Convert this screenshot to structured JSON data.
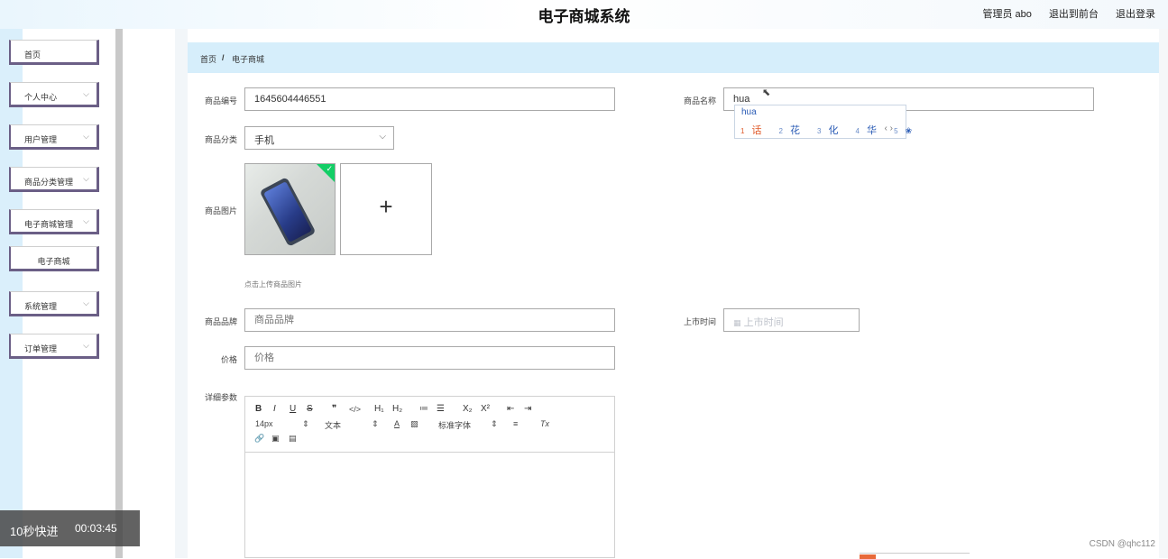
{
  "header": {
    "title": "电子商城系统",
    "admin_label": "管理员 abo",
    "to_front": "退出到前台",
    "logout": "退出登录"
  },
  "sidebar": {
    "items": [
      {
        "label": "首页",
        "chevron": false
      },
      {
        "label": "个人中心",
        "chevron": true
      },
      {
        "label": "用户管理",
        "chevron": true
      },
      {
        "label": "商品分类管理",
        "chevron": true
      },
      {
        "label": "电子商城管理",
        "chevron": true
      },
      {
        "label": "电子商城",
        "chevron": false,
        "sub": true
      },
      {
        "label": "系统管理",
        "chevron": true
      },
      {
        "label": "订单管理",
        "chevron": true
      }
    ],
    "chevron_glyph": "⌵"
  },
  "breadcrumb": {
    "home": "首页",
    "sep": "/",
    "current": "电子商城"
  },
  "form": {
    "product_no_label": "商品编号",
    "product_no_value": "1645604446551",
    "product_name_label": "商品名称",
    "product_name_value": "hua",
    "category_label": "商品分类",
    "category_value": "手机",
    "image_label": "商品图片",
    "upload_plus": "+",
    "upload_hint": "点击上传商品图片",
    "brand_label": "商品品牌",
    "brand_placeholder": "商品品牌",
    "launch_label": "上市时间",
    "launch_placeholder": "上市时间",
    "price_label": "价格",
    "price_placeholder": "价格",
    "details_label": "详细参数"
  },
  "editor": {
    "row1": [
      "B",
      "I",
      "U",
      "S",
      "❞",
      "</>",
      "H₁",
      "H₂",
      "≔",
      "☰",
      "X₂",
      "X²",
      "⇤",
      "⇥"
    ],
    "font_size": "14px",
    "text_style": "文本",
    "font_family": "标准字体",
    "row2_icons": [
      "A",
      "▨",
      "≡",
      "Tx"
    ],
    "row3": [
      "🔗",
      "▣",
      "▤"
    ]
  },
  "ime": {
    "pinyin": "hua",
    "candidates": [
      {
        "n": "1",
        "c": "话"
      },
      {
        "n": "2",
        "c": "花"
      },
      {
        "n": "3",
        "c": "化"
      },
      {
        "n": "4",
        "c": "华"
      },
      {
        "n": "5",
        "c": "❀"
      }
    ],
    "nav": "‹ ›"
  },
  "overlay": {
    "speed": "10秒快进",
    "time": "00:03:45"
  },
  "watermark": "CSDN @qhc112",
  "colors": {
    "accent_green": "#13ce66",
    "sidebar_border": "#6b5f86",
    "crumb_bg": "#d6eefb"
  }
}
